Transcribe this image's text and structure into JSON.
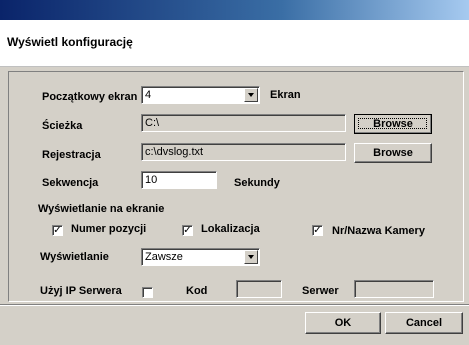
{
  "dialog": {
    "title": "Wyświetl konfigurację"
  },
  "start_screen": {
    "label": "Początkowy ekran",
    "value": "4",
    "suffix": "Ekran"
  },
  "path": {
    "label": "Ścieżka",
    "value": "C:\\",
    "browse_label": "Browse"
  },
  "logging": {
    "label": "Rejestracja",
    "value": "c:\\dvslog.txt",
    "browse_label": "Browse"
  },
  "sequence": {
    "label": "Sekwencja",
    "value": "10",
    "suffix": "Sekundy"
  },
  "onscreen": {
    "label": "Wyświetlanie na ekranie",
    "position_number": {
      "label": "Numer pozycji",
      "checked": true,
      "mark": "✓"
    },
    "location": {
      "label": "Lokalizacja",
      "checked": true,
      "mark": "✓"
    },
    "camera_name": {
      "label": "Nr/Nazwa Kamery",
      "checked": true,
      "mark": "✓"
    }
  },
  "display": {
    "label": "Wyświetlanie",
    "value": "Zawsze"
  },
  "server": {
    "use_ip_label": "Użyj IP Serwera",
    "use_ip_checked": false,
    "code_label": "Kod",
    "code_value": "",
    "server_label": "Serwer",
    "server_value": ""
  },
  "footer": {
    "ok_label": "OK",
    "cancel_label": "Cancel"
  }
}
